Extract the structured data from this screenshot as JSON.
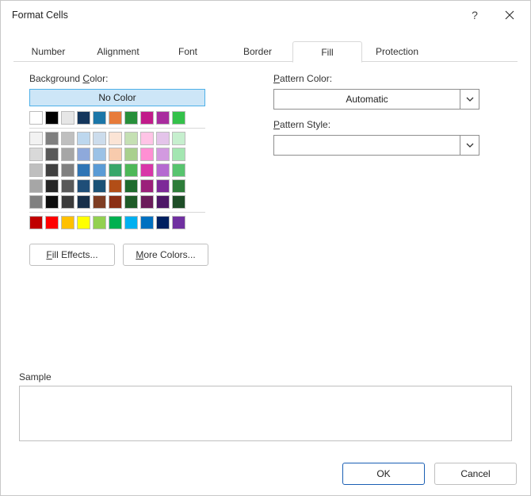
{
  "titlebar": {
    "title": "Format Cells",
    "help": "?",
    "close": "✕"
  },
  "tabs": [
    "Number",
    "Alignment",
    "Font",
    "Border",
    "Fill",
    "Protection"
  ],
  "active_tab_index": 4,
  "fill": {
    "bg_label": "Background Color:",
    "bg_label_u": "C",
    "no_color": "No Color",
    "palette_top": [
      [
        "#ffffff",
        "#000000",
        "#e6e6e6",
        "#14365c",
        "#1b76a8",
        "#e77b3a",
        "#278f3a",
        "#c11b8a",
        "#a82c9e",
        "#34c14a"
      ]
    ],
    "palette_main": [
      [
        "#f2f2f2",
        "#7f7f7f",
        "#bfbfbf",
        "#bdd7ee",
        "#ccdcec",
        "#fbe4d5",
        "#c5e0b3",
        "#ffc4e6",
        "#e4c4ea",
        "#c6efce"
      ],
      [
        "#d9d9d9",
        "#595959",
        "#a6a6a6",
        "#8ea9db",
        "#9bc2e6",
        "#f8cbad",
        "#a9d08e",
        "#ff8fd3",
        "#d29ae0",
        "#a3e6b1"
      ],
      [
        "#bfbfbf",
        "#404040",
        "#808080",
        "#2f75b5",
        "#5b9bd5",
        "#38a66a",
        "#4eb859",
        "#d837a8",
        "#b56ad0",
        "#58c46f"
      ],
      [
        "#a6a6a6",
        "#262626",
        "#595959",
        "#1f4e78",
        "#1a5276",
        "#b24e17",
        "#1e6b2d",
        "#9b1f7a",
        "#7d2a98",
        "#2e7d3a"
      ],
      [
        "#808080",
        "#0d0d0d",
        "#3b3b3b",
        "#172f4a",
        "#7e3d23",
        "#8b2f14",
        "#1e5b28",
        "#6a1b5a",
        "#4d1766",
        "#1e4d27"
      ]
    ],
    "palette_standard": [
      [
        "#c00000",
        "#ff0000",
        "#ffc000",
        "#ffff00",
        "#92d050",
        "#00b050",
        "#00b0f0",
        "#0070c0",
        "#002060",
        "#7030a0"
      ]
    ],
    "fill_effects": "Fill Effects...",
    "more_colors": "More Colors..."
  },
  "pattern": {
    "color_label": "Pattern Color:",
    "color_value": "Automatic",
    "style_label": "Pattern Style:",
    "style_value": ""
  },
  "sample_label": "Sample",
  "footer": {
    "ok": "OK",
    "cancel": "Cancel"
  }
}
